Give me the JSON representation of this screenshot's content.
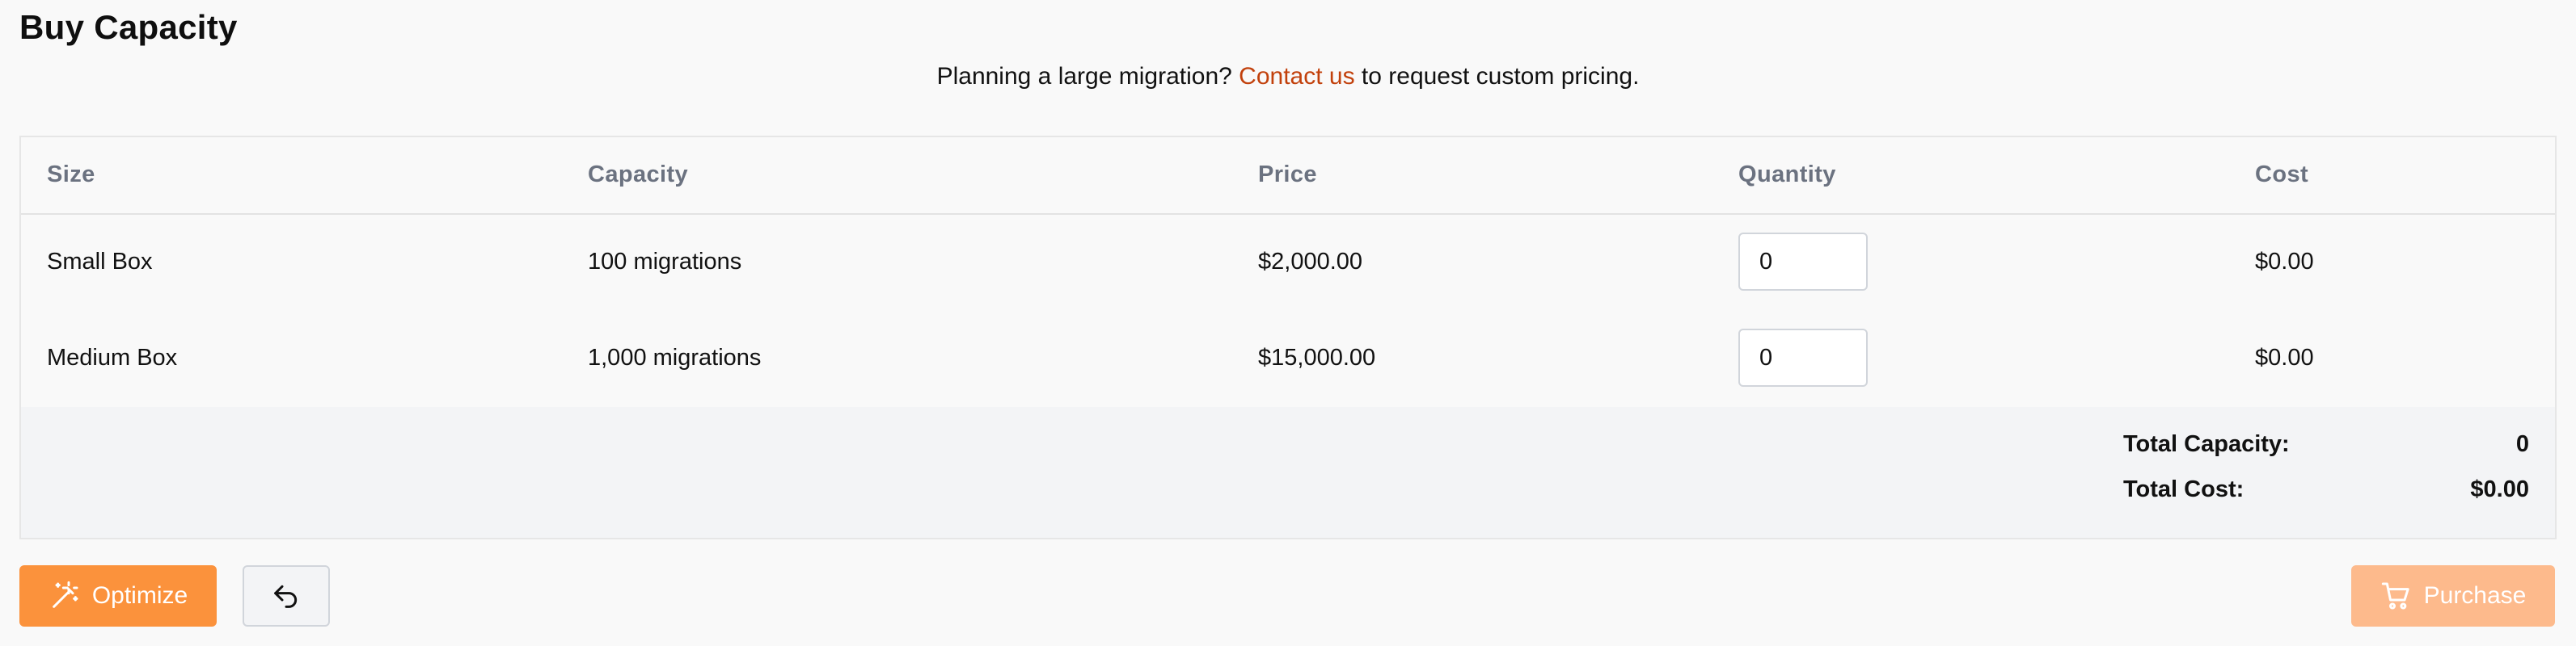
{
  "page": {
    "title": "Buy Capacity",
    "notice_prefix": "Planning a large migration? ",
    "notice_link": "Contact us",
    "notice_suffix": " to request custom pricing."
  },
  "table": {
    "columns": [
      "Size",
      "Capacity",
      "Price",
      "Quantity",
      "Cost"
    ],
    "rows": [
      {
        "size": "Small Box",
        "capacity": "100 migrations",
        "price": "$2,000.00",
        "quantity": "0",
        "cost": "$0.00"
      },
      {
        "size": "Medium Box",
        "capacity": "1,000 migrations",
        "price": "$15,000.00",
        "quantity": "0",
        "cost": "$0.00"
      }
    ],
    "totals": {
      "capacity_label": "Total Capacity:",
      "capacity_value": "0",
      "cost_label": "Total Cost:",
      "cost_value": "$0.00"
    }
  },
  "actions": {
    "optimize_label": "Optimize",
    "optimize_icon": "magic-wand-icon",
    "undo_icon": "undo-icon",
    "purchase_label": "Purchase",
    "purchase_icon": "cart-icon"
  },
  "colors": {
    "accent": "#fb923c",
    "accent_disabled": "#fdba8c",
    "link": "#c2410c",
    "header_text": "#6b7280"
  }
}
